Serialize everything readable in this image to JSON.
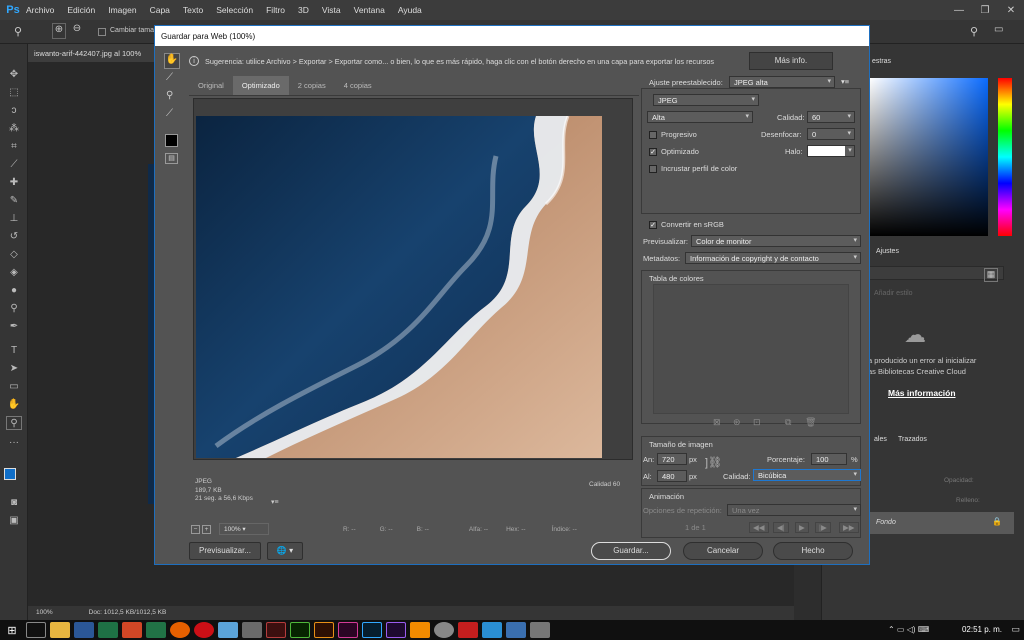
{
  "app": {
    "logo": "Ps",
    "menus": [
      "Archivo",
      "Edición",
      "Imagen",
      "Capa",
      "Texto",
      "Selección",
      "Filtro",
      "3D",
      "Vista",
      "Ventana",
      "Ayuda"
    ]
  },
  "optbar": {
    "checkbox_label": "Cambiar tama"
  },
  "doc": {
    "tab": "iswanto-arif-442407.jpg al 100%",
    "zoom": "100%",
    "status": "Doc: 1012,5 KB/1012,5 KB"
  },
  "right": {
    "panel_title": "estras",
    "adjust_tab": "Ajustes",
    "add_style": "Añadir estilo",
    "error_text1": "a producido un error al inicializar",
    "error_text2": "as Bibliotecas Creative Cloud",
    "more_info": "Más información",
    "tab_capas": "ales",
    "tab_trazados": "Trazados",
    "opacity": "Opacidad:",
    "fill": "Relleno:",
    "layer": "Fondo"
  },
  "dialog": {
    "title": "Guardar para Web (100%)",
    "hint": "Sugerencia: utilice Archivo > Exportar > Exportar como... o bien, lo que es más rápido, haga clic con el botón derecho en una capa para exportar los recursos",
    "more_info": "Más info.",
    "tabs": [
      "Original",
      "Optimizado",
      "2 copias",
      "4 copias"
    ],
    "photo_info": {
      "format": "JPEG",
      "size": "189,7 KB",
      "time": "21 seg. a 56,6 Kbps"
    },
    "photo_quality": "Calidad 60",
    "zoom": "100%",
    "readouts": [
      "R: --",
      "G: --",
      "B: --",
      "Alfa: --",
      "Hex: --",
      "Índice: --"
    ],
    "buttons": {
      "preview": "Previsualizar...",
      "save": "Guardar...",
      "cancel": "Cancelar",
      "done": "Hecho"
    },
    "settings": {
      "preset_label": "Ajuste preestablecido:",
      "preset_value": "JPEG alta",
      "format": "JPEG",
      "quality_level": "Alta",
      "quality_label": "Calidad:",
      "quality_value": "60",
      "progressive": "Progresivo",
      "blur_label": "Desenfocar:",
      "blur_value": "0",
      "optimized": "Optimizado",
      "matte_label": "Halo:",
      "embed_profile": "Incrustar perfil de color",
      "convert_srgb": "Convertir en sRGB",
      "preview_label": "Previsualizar:",
      "preview_value": "Color de monitor",
      "metadata_label": "Metadatos:",
      "metadata_value": "Información de copyright y de contacto",
      "color_table": "Tabla de colores",
      "image_size": "Tamaño de imagen",
      "width_label": "An:",
      "width_value": "720",
      "height_label": "Al:",
      "height_value": "480",
      "px": "px",
      "percent_label": "Porcentaje:",
      "percent_value": "100",
      "percent_sign": "%",
      "resample_label": "Calidad:",
      "resample_value": "Bicúbica",
      "animation": "Animación",
      "loop_label": "Opciones de repetición:",
      "loop_value": "Una vez",
      "frame": "1 de 1"
    }
  },
  "taskbar": {
    "time": "02:51 p. m."
  }
}
